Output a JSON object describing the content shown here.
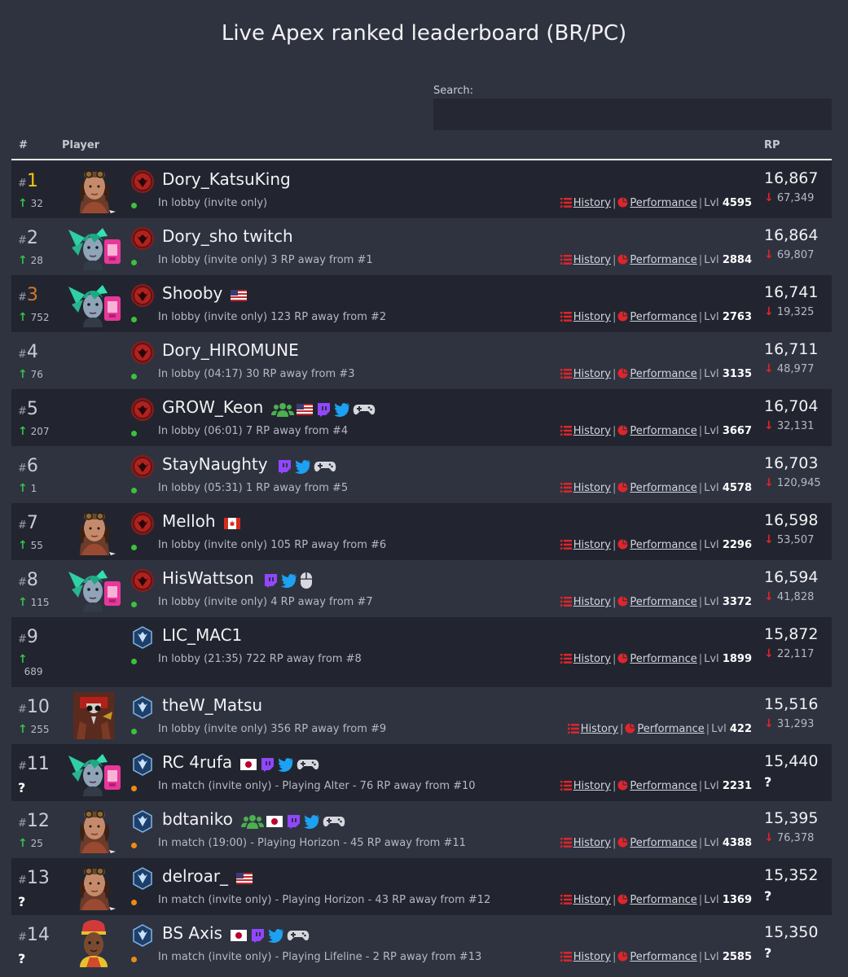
{
  "page": {
    "title": "Live Apex ranked leaderboard (BR/PC)"
  },
  "search": {
    "label": "Search:",
    "value": "",
    "placeholder": ""
  },
  "table": {
    "headers": {
      "rank": "#",
      "player": "Player",
      "rp": "RP"
    }
  },
  "links": {
    "history": "History",
    "performance": "Performance",
    "level_prefix": "Lvl"
  },
  "colors": {
    "background": "#2f3340",
    "row_alt": "#22252f",
    "rank_gold": "#f3c40e",
    "rank_bronze": "#d07a2e",
    "up": "#31c24a",
    "down": "#e0252a",
    "online": "#3bc23a",
    "in_match": "#f08a12",
    "link_icon": "#e0252a"
  },
  "rows": [
    {
      "rank_prefix": "#",
      "rank": "1",
      "rank_style": "gold",
      "change": "32",
      "change_dir": "up",
      "avatar": "horizon",
      "tier": "predator-icon",
      "name": "Dory_KatsuKing",
      "extras": [],
      "status": "In lobby (invite only)",
      "status_color": "green",
      "level": "4595",
      "rp": "16,867",
      "rp_change": "67,349",
      "rp_dir": "down"
    },
    {
      "rank_prefix": "#",
      "rank": "2",
      "rank_style": "normal",
      "change": "28",
      "change_dir": "up",
      "avatar": "alter",
      "tier": "predator-icon",
      "name": "Dory_sho twitch",
      "extras": [],
      "status": "In lobby (invite only) 3 RP away from #1",
      "status_color": "green",
      "level": "2884",
      "rp": "16,864",
      "rp_change": "69,807",
      "rp_dir": "down"
    },
    {
      "rank_prefix": "#",
      "rank": "3",
      "rank_style": "bronze",
      "change": "752",
      "change_dir": "up",
      "avatar": "alter",
      "tier": "predator-icon",
      "name": "Shooby",
      "extras": [
        "flag-us"
      ],
      "status": "In lobby (invite only) 123 RP away from #2",
      "status_color": "green",
      "level": "2763",
      "rp": "16,741",
      "rp_change": "19,325",
      "rp_dir": "down"
    },
    {
      "rank_prefix": "#",
      "rank": "4",
      "rank_style": "normal",
      "change": "76",
      "change_dir": "up",
      "avatar": "",
      "tier": "predator-icon",
      "name": "Dory_HIROMUNE",
      "extras": [],
      "status": "In lobby (04:17) 30 RP away from #3",
      "status_color": "green",
      "level": "3135",
      "rp": "16,711",
      "rp_change": "48,977",
      "rp_dir": "down"
    },
    {
      "rank_prefix": "#",
      "rank": "5",
      "rank_style": "normal",
      "change": "207",
      "change_dir": "up",
      "avatar": "",
      "tier": "predator-icon",
      "name": "GROW_Keon",
      "extras": [
        "group-icon",
        "flag-us",
        "twitch-icon",
        "twitter-icon",
        "gamepad-icon"
      ],
      "status": "In lobby (06:01) 7 RP away from #4",
      "status_color": "green",
      "level": "3667",
      "rp": "16,704",
      "rp_change": "32,131",
      "rp_dir": "down"
    },
    {
      "rank_prefix": "#",
      "rank": "6",
      "rank_style": "normal",
      "change": "1",
      "change_dir": "up",
      "avatar": "",
      "tier": "predator-icon",
      "name": "StayNaughty",
      "extras": [
        "twitch-icon",
        "twitter-icon",
        "gamepad-icon"
      ],
      "status": "In lobby (05:31) 1 RP away from #5",
      "status_color": "green",
      "level": "4578",
      "rp": "16,703",
      "rp_change": "120,945",
      "rp_dir": "down"
    },
    {
      "rank_prefix": "#",
      "rank": "7",
      "rank_style": "normal",
      "change": "55",
      "change_dir": "up",
      "avatar": "horizon",
      "tier": "predator-icon",
      "name": "Melloh",
      "extras": [
        "flag-ca"
      ],
      "status": "In lobby (invite only) 105 RP away from #6",
      "status_color": "green",
      "level": "2296",
      "rp": "16,598",
      "rp_change": "53,507",
      "rp_dir": "down"
    },
    {
      "rank_prefix": "#",
      "rank": "8",
      "rank_style": "normal",
      "change": "115",
      "change_dir": "up",
      "avatar": "alter",
      "tier": "predator-icon",
      "name": "HisWattson",
      "extras": [
        "twitch-icon",
        "twitter-icon",
        "mouse-icon"
      ],
      "status": "In lobby (invite only) 4 RP away from #7",
      "status_color": "green",
      "level": "3372",
      "rp": "16,594",
      "rp_change": "41,828",
      "rp_dir": "down"
    },
    {
      "rank_prefix": "#",
      "rank": "9",
      "rank_style": "normal",
      "change": "689",
      "change_dir": "up-wrap",
      "avatar": "",
      "tier": "master-icon",
      "name": "LIC_MAC1",
      "extras": [],
      "status": "In lobby (21:35) 722 RP away from #8",
      "status_color": "green",
      "level": "1899",
      "rp": "15,872",
      "rp_change": "22,117",
      "rp_dir": "down"
    },
    {
      "rank_prefix": "#",
      "rank": "10",
      "rank_style": "normal",
      "change": "255",
      "change_dir": "up",
      "avatar": "bloodhound",
      "tier": "master-icon",
      "name": "theW_Matsu",
      "extras": [],
      "status": "In lobby (invite only) 356 RP away from #9",
      "status_color": "green",
      "level": "422",
      "rp": "15,516",
      "rp_change": "31,293",
      "rp_dir": "down"
    },
    {
      "rank_prefix": "#",
      "rank": "11",
      "rank_style": "normal",
      "change": "?",
      "change_dir": "unknown",
      "avatar": "alter",
      "tier": "master-icon",
      "name": "RC 4rufa",
      "extras": [
        "flag-jp",
        "twitch-icon",
        "twitter-icon",
        "gamepad-icon"
      ],
      "status": "In match (invite only) - Playing Alter - 76 RP away from #10",
      "status_color": "orange",
      "level": "2231",
      "rp": "15,440",
      "rp_change": "?",
      "rp_dir": "unknown"
    },
    {
      "rank_prefix": "#",
      "rank": "12",
      "rank_style": "normal",
      "change": "25",
      "change_dir": "up",
      "avatar": "horizon",
      "tier": "master-icon",
      "name": "bdtaniko",
      "extras": [
        "group-icon",
        "flag-jp",
        "twitch-icon",
        "twitter-icon",
        "gamepad-icon"
      ],
      "status": "In match (19:00) - Playing Horizon - 45 RP away from #11",
      "status_color": "orange",
      "level": "4388",
      "rp": "15,395",
      "rp_change": "76,378",
      "rp_dir": "down"
    },
    {
      "rank_prefix": "#",
      "rank": "13",
      "rank_style": "normal",
      "change": "?",
      "change_dir": "unknown",
      "avatar": "horizon",
      "tier": "master-icon",
      "name": "delroar_",
      "extras": [
        "flag-us"
      ],
      "status": "In match (invite only) - Playing Horizon - 43 RP away from #12",
      "status_color": "orange",
      "level": "1369",
      "rp": "15,352",
      "rp_change": "?",
      "rp_dir": "unknown"
    },
    {
      "rank_prefix": "#",
      "rank": "14",
      "rank_style": "normal",
      "change": "?",
      "change_dir": "unknown",
      "avatar": "lifeline",
      "tier": "master-icon",
      "name": "BS Axis",
      "extras": [
        "flag-jp",
        "twitch-icon",
        "twitter-icon",
        "gamepad-icon"
      ],
      "status": "In match (invite only) - Playing Lifeline - 2 RP away from #13",
      "status_color": "orange",
      "level": "2585",
      "rp": "15,350",
      "rp_change": "?",
      "rp_dir": "unknown"
    }
  ]
}
